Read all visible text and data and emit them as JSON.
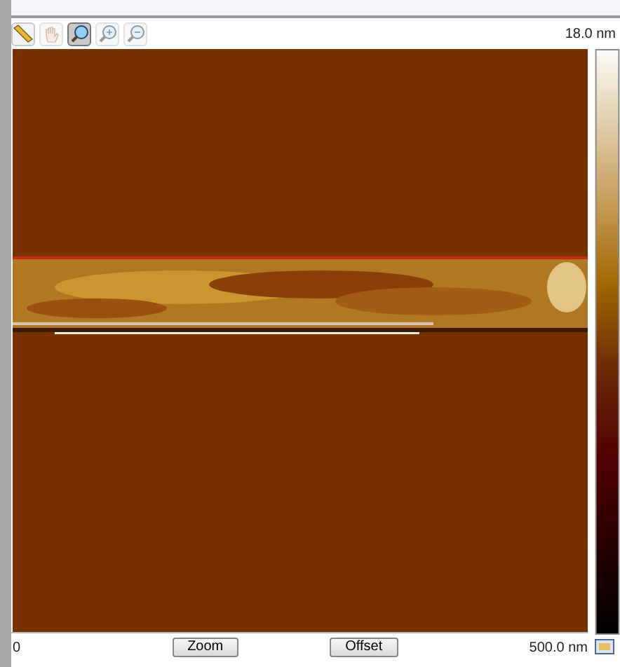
{
  "toolbar": {
    "tools": [
      {
        "kind": "ruler",
        "selected": false,
        "disabled": false
      },
      {
        "kind": "hand",
        "selected": false,
        "disabled": true
      },
      {
        "kind": "zoom",
        "selected": true,
        "disabled": false
      },
      {
        "kind": "zoom-in",
        "selected": false,
        "disabled": true
      },
      {
        "kind": "zoom-out",
        "selected": false,
        "disabled": true
      }
    ]
  },
  "color_scale": {
    "max_label": "18.0 nm"
  },
  "footer": {
    "x_min": "0",
    "buttons": [
      "Zoom",
      "Offset"
    ],
    "x_max": "500.0 nm"
  }
}
